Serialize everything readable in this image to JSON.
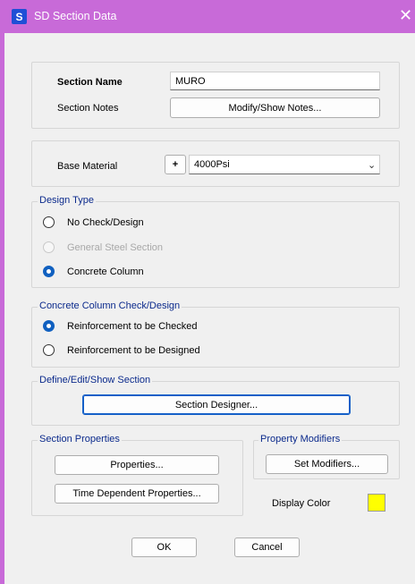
{
  "window": {
    "title": "SD Section Data",
    "app_icon_letter": "S"
  },
  "section": {
    "name_label": "Section Name",
    "name_value": "MURO",
    "notes_label": "Section Notes",
    "notes_button": "Modify/Show Notes..."
  },
  "material": {
    "label": "Base Material",
    "add_button": "+",
    "selected": "4000Psi"
  },
  "design_type": {
    "legend": "Design Type",
    "options": [
      {
        "label": "No Check/Design",
        "checked": false,
        "enabled": true
      },
      {
        "label": "General Steel Section",
        "checked": false,
        "enabled": false
      },
      {
        "label": "Concrete Column",
        "checked": true,
        "enabled": true
      }
    ]
  },
  "concrete_check": {
    "legend": "Concrete Column Check/Design",
    "options": [
      {
        "label": "Reinforcement to be Checked",
        "checked": true
      },
      {
        "label": "Reinforcement to be Designed",
        "checked": false
      }
    ]
  },
  "define_section": {
    "legend": "Define/Edit/Show Section",
    "button": "Section Designer..."
  },
  "section_properties": {
    "legend": "Section Properties",
    "properties_button": "Properties...",
    "time_dependent_button": "Time Dependent Properties..."
  },
  "property_modifiers": {
    "legend": "Property Modifiers",
    "button": "Set Modifiers..."
  },
  "display_color": {
    "label": "Display Color",
    "color": "#ffff00"
  },
  "footer": {
    "ok": "OK",
    "cancel": "Cancel"
  },
  "colors": {
    "titlebar": "#c86ad8",
    "legend_text": "#0b2a8c",
    "radio_checked": "#1060c0"
  }
}
